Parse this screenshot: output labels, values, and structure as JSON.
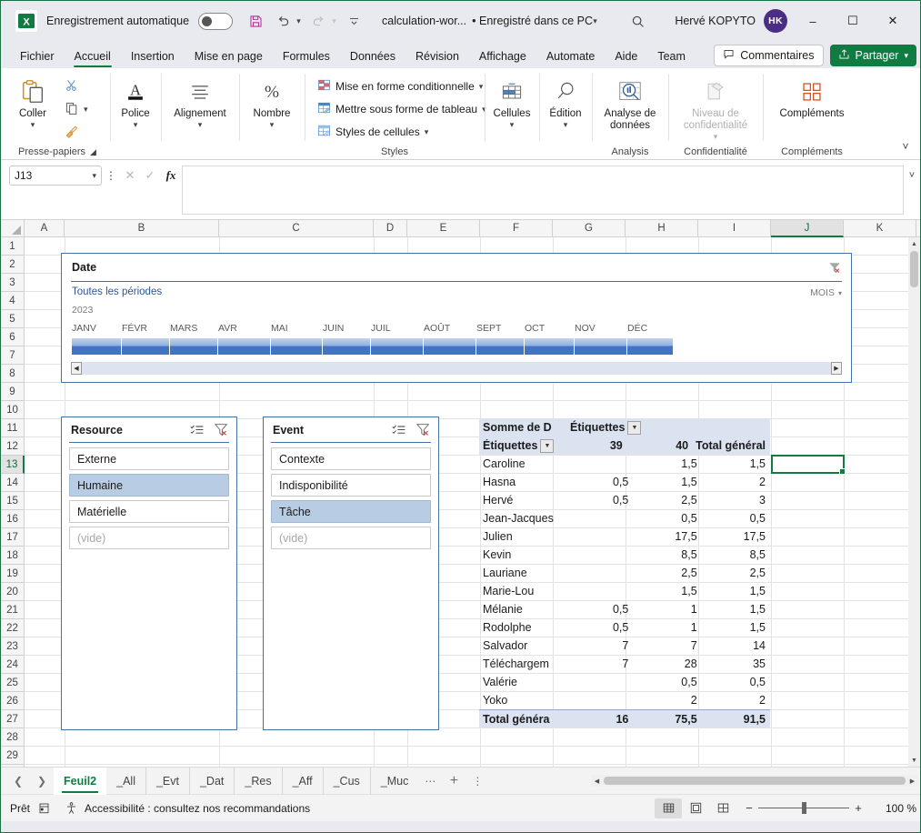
{
  "titlebar": {
    "autosave_label": "Enregistrement automatique",
    "autosave_state": "off",
    "save_icon": "save-icon",
    "undo_icon": "undo-icon",
    "redo_icon": "redo-icon",
    "qat_more_icon": "quick-access-more-icon",
    "filename": "calculation-wor...",
    "saved_location": "• Enregistré dans ce PC",
    "search_icon": "search-icon",
    "account_name": "Hervé KOPYTO",
    "avatar_initials": "HK",
    "minimize": "–",
    "maximize": "☐",
    "close": "✕"
  },
  "ribbon_tabs": {
    "items": [
      {
        "label": "Fichier",
        "active": false
      },
      {
        "label": "Accueil",
        "active": true
      },
      {
        "label": "Insertion",
        "active": false
      },
      {
        "label": "Mise en page",
        "active": false
      },
      {
        "label": "Formules",
        "active": false
      },
      {
        "label": "Données",
        "active": false
      },
      {
        "label": "Révision",
        "active": false
      },
      {
        "label": "Affichage",
        "active": false
      },
      {
        "label": "Automate",
        "active": false
      },
      {
        "label": "Aide",
        "active": false
      },
      {
        "label": "Team",
        "active": false
      }
    ],
    "comments_label": "Commentaires",
    "share_label": "Partager"
  },
  "ribbon": {
    "groups": [
      {
        "name": "Presse-papiers",
        "label": "Presse-papiers"
      },
      {
        "name": "Police",
        "label": ""
      },
      {
        "name": "Alignement",
        "label": ""
      },
      {
        "name": "Nombre",
        "label": ""
      },
      {
        "name": "Styles",
        "label": "Styles"
      },
      {
        "name": "Cellules",
        "label": ""
      },
      {
        "name": "Edition",
        "label": ""
      },
      {
        "name": "Analysis",
        "label": "Analysis"
      },
      {
        "name": "Confidentialité",
        "label": "Confidentialité"
      },
      {
        "name": "Compléments",
        "label": "Compléments"
      }
    ],
    "paste_label": "Coller",
    "clipboard_label": "Presse-papiers",
    "font_label": "Police",
    "align_label": "Alignement",
    "number_label": "Nombre",
    "cond_format_label": "Mise en forme conditionnelle",
    "table_format_label": "Mettre sous forme de tableau",
    "cell_styles_label": "Styles de cellules",
    "styles_label": "Styles",
    "cells_label": "Cellules",
    "edition_label": "Édition",
    "analyse_label": "Analyse de données",
    "analysis_label": "Analysis",
    "sensitivity_label": "Niveau de confidentialité",
    "confidentialite_label": "Confidentialité",
    "addins_label": "Compléments",
    "addins_group_label": "Compléments"
  },
  "formula_bar": {
    "name_box": "J13",
    "cancel_icon": "cancel-icon",
    "confirm_icon": "confirm-icon",
    "fx_icon": "fx-icon",
    "formula_value": "",
    "formula_placeholder": ""
  },
  "grid": {
    "columns": [
      "A",
      "B",
      "C",
      "D",
      "E",
      "F",
      "G",
      "H",
      "I",
      "J",
      "K"
    ],
    "selected_column": "J",
    "rows": [
      1,
      2,
      3,
      4,
      5,
      6,
      7,
      8,
      9,
      10,
      11,
      12,
      13,
      14,
      15,
      16,
      17,
      18,
      19,
      20,
      21,
      22,
      23,
      24,
      25,
      26,
      27,
      28,
      29
    ],
    "selected_row": 13,
    "selected_cell": "J13"
  },
  "timeline": {
    "title": "Date",
    "clear_filter_icon": "clear-filter-icon",
    "subtitle": "Toutes les périodes",
    "level": "MOIS",
    "level_caret_icon": "chevron-down-icon",
    "year": "2023",
    "months": [
      "JANV",
      "FÉVR",
      "MARS",
      "AVR",
      "MAI",
      "JUIN",
      "JUIL",
      "AOÛT",
      "SEPT",
      "OCT",
      "NOV",
      "DÉC"
    ],
    "selected_months": [
      "JANV",
      "FÉVR",
      "MARS",
      "AVR",
      "MAI",
      "JUIN",
      "JUIL",
      "AOÛT",
      "SEPT",
      "OCT",
      "NOV",
      "DÉC"
    ],
    "scroll_left_icon": "scroll-left-icon",
    "scroll_right_icon": "scroll-right-icon"
  },
  "slicers": [
    {
      "title": "Resource",
      "multiselect_icon": "multiselect-icon",
      "clear_filter_icon": "clear-filter-icon",
      "items": [
        {
          "label": "Externe",
          "selected": false,
          "empty": false
        },
        {
          "label": "Humaine",
          "selected": true,
          "empty": false
        },
        {
          "label": "Matérielle",
          "selected": false,
          "empty": false
        },
        {
          "label": "(vide)",
          "selected": false,
          "empty": true
        }
      ]
    },
    {
      "title": "Event",
      "multiselect_icon": "multiselect-icon",
      "clear_filter_icon": "clear-filter-icon",
      "items": [
        {
          "label": "Contexte",
          "selected": false,
          "empty": false
        },
        {
          "label": "Indisponibilité",
          "selected": false,
          "empty": false
        },
        {
          "label": "Tâche",
          "selected": true,
          "empty": false
        },
        {
          "label": "(vide)",
          "selected": false,
          "empty": true
        }
      ]
    }
  ],
  "pivot": {
    "value_header": "Somme de D",
    "column_header": "Étiquettes",
    "row_header": "Étiquettes",
    "column_labels": [
      "39",
      "40",
      "Total général"
    ],
    "rows": [
      {
        "label": "Caroline",
        "values": [
          "",
          "1,5",
          "1,5"
        ]
      },
      {
        "label": "Hasna",
        "values": [
          "0,5",
          "1,5",
          "2"
        ]
      },
      {
        "label": "Hervé",
        "values": [
          "0,5",
          "2,5",
          "3"
        ]
      },
      {
        "label": "Jean-Jacques",
        "values": [
          "",
          "0,5",
          "0,5"
        ]
      },
      {
        "label": "Julien",
        "values": [
          "",
          "17,5",
          "17,5"
        ]
      },
      {
        "label": "Kevin",
        "values": [
          "",
          "8,5",
          "8,5"
        ]
      },
      {
        "label": "Lauriane",
        "values": [
          "",
          "2,5",
          "2,5"
        ]
      },
      {
        "label": "Marie-Lou",
        "values": [
          "",
          "1,5",
          "1,5"
        ]
      },
      {
        "label": "Mélanie",
        "values": [
          "0,5",
          "1",
          "1,5"
        ]
      },
      {
        "label": "Rodolphe",
        "values": [
          "0,5",
          "1",
          "1,5"
        ]
      },
      {
        "label": "Salvador",
        "values": [
          "7",
          "7",
          "14"
        ]
      },
      {
        "label": "Téléchargem",
        "values": [
          "7",
          "28",
          "35"
        ]
      },
      {
        "label": "Valérie",
        "values": [
          "",
          "0,5",
          "0,5"
        ]
      },
      {
        "label": "Yoko",
        "values": [
          "",
          "2",
          "2"
        ]
      }
    ],
    "total_label": "Total généra",
    "total_values": [
      "16",
      "75,5",
      "91,5"
    ]
  },
  "sheet_tabs": {
    "prev_icon": "chevron-left-icon",
    "next_icon": "chevron-right-icon",
    "tabs": [
      {
        "label": "Feuil2",
        "active": true
      },
      {
        "label": "_All",
        "active": false
      },
      {
        "label": "_Evt",
        "active": false
      },
      {
        "label": "_Dat",
        "active": false
      },
      {
        "label": "_Res",
        "active": false
      },
      {
        "label": "_Aff",
        "active": false
      },
      {
        "label": "_Cus",
        "active": false
      },
      {
        "label": "_Muc",
        "active": false
      }
    ],
    "more_icon": "more-sheets-icon",
    "add_icon": "add-sheet-icon",
    "options_icon": "sheet-options-icon"
  },
  "statusbar": {
    "status": "Prêt",
    "macro_icon": "record-macro-icon",
    "accessibility_icon": "accessibility-icon",
    "accessibility_text": "Accessibilité : consultez nos recommandations",
    "view_normal_icon": "normal-view-icon",
    "view_layout_icon": "page-layout-icon",
    "view_break_icon": "page-break-view-icon",
    "zoom_out": "−",
    "zoom_in": "+",
    "zoom_value": "100 %"
  }
}
